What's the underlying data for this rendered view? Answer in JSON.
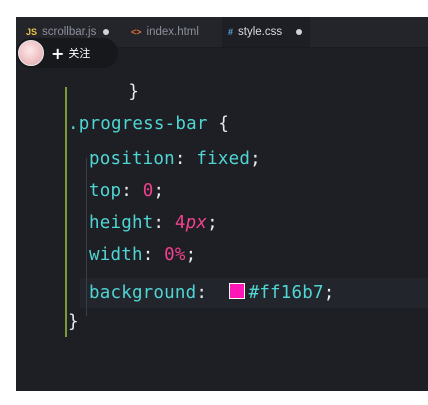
{
  "tabs": [
    {
      "icon": "JS",
      "label": "scrollbar.js",
      "modified": true,
      "active": false,
      "icon_color": "#e8c547"
    },
    {
      "icon": "<>",
      "label": "index.html",
      "modified": false,
      "active": false,
      "icon_color": "#e3703b"
    },
    {
      "icon": "#",
      "label": "style.css",
      "modified": true,
      "active": true,
      "icon_color": "#56a6e0"
    }
  ],
  "follow": {
    "plus": "+",
    "label": "关注"
  },
  "code": {
    "selector": ".progress-bar",
    "open_brace": "{",
    "close_brace": "}",
    "prev_close_brace": "}",
    "decls": [
      {
        "prop": "position",
        "value": "fixed"
      },
      {
        "prop": "top",
        "value": "0"
      },
      {
        "prop": "height",
        "value_num": "4",
        "value_unit": "px"
      },
      {
        "prop": "width",
        "value_num": "0",
        "value_unit": "%"
      },
      {
        "prop": "background",
        "value": "#ff16b7"
      }
    ]
  },
  "colors": {
    "editor_bg": "#1e1f24",
    "swatch": "#ff16b7",
    "guide": "#7d9a33"
  }
}
